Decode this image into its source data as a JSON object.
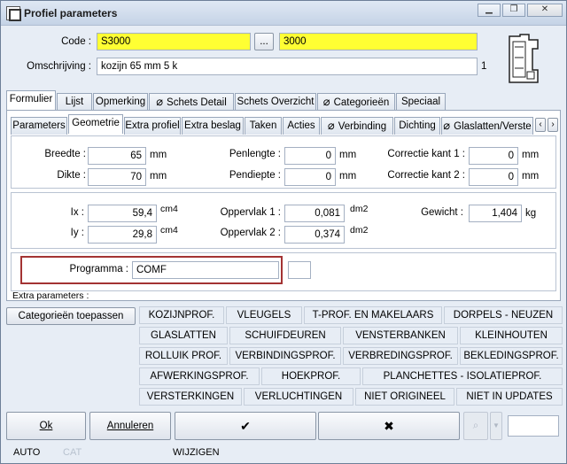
{
  "window": {
    "title": "Profiel parameters"
  },
  "header": {
    "code_label": "Code :",
    "code_value": "S3000",
    "browse_label": "...",
    "code2_value": "3000",
    "omschrijving_label": "Omschrijving :",
    "omschrijving_value": "kozijn 65 mm 5 k",
    "count": "1"
  },
  "main_tabs": [
    "Formulier",
    "Lijst",
    "Opmerking",
    "Schets Detail",
    "Schets Overzicht",
    "Categorieën",
    "Speciaal"
  ],
  "sub_tabs": [
    "Parameters",
    "Geometrie",
    "Extra profiel",
    "Extra beslag",
    "Taken",
    "Acties",
    "Verbinding",
    "Dichting",
    "Glaslatten/Verste"
  ],
  "geometry": {
    "breedte_label": "Breedte :",
    "breedte_value": "65",
    "breedte_unit": "mm",
    "dikte_label": "Dikte :",
    "dikte_value": "70",
    "dikte_unit": "mm",
    "penlengte_label": "Penlengte :",
    "penlengte_value": "0",
    "penlengte_unit": "mm",
    "pendiepte_label": "Pendiepte :",
    "pendiepte_value": "0",
    "pendiepte_unit": "mm",
    "correctie1_label": "Correctie kant 1 :",
    "correctie1_value": "0",
    "correctie1_unit": "mm",
    "correctie2_label": "Correctie kant 2 :",
    "correctie2_value": "0",
    "correctie2_unit": "mm"
  },
  "properties": {
    "ix_label": "Ix :",
    "ix_value": "59,4",
    "ix_unit": "cm4",
    "iy_label": "Iy :",
    "iy_value": "29,8",
    "iy_unit": "cm4",
    "opp1_label": "Oppervlak 1 :",
    "opp1_value": "0,081",
    "opp1_unit": "dm2",
    "opp2_label": "Oppervlak 2 :",
    "opp2_value": "0,374",
    "opp2_unit": "dm2",
    "gewicht_label": "Gewicht :",
    "gewicht_value": "1,404",
    "gewicht_unit": "kg"
  },
  "programma": {
    "label": "Programma :",
    "value": "COMF"
  },
  "extra_parameters_label": "Extra parameters :",
  "categories": {
    "apply_label": "Categorieën toepassen",
    "rows": [
      [
        "KOZIJNPROF.",
        "VLEUGELS",
        "T-PROF. EN MAKELAARS",
        "DORPELS - NEUZEN"
      ],
      [
        "GLASLATTEN",
        "SCHUIFDEUREN",
        "VENSTERBANKEN",
        "KLEINHOUTEN"
      ],
      [
        "ROLLUIK PROF.",
        "VERBINDINGSPROF.",
        "VERBREDINGSPROF.",
        "BEKLEDINGSPROF."
      ],
      [
        "AFWERKINGSPROF.",
        "HOEKPROF.",
        "PLANCHETTES - ISOLATIEPROF.",
        ""
      ],
      [
        "VERSTERKINGEN",
        "VERLUCHTINGEN",
        "NIET ORIGINEEL",
        "NIET IN UPDATES"
      ]
    ]
  },
  "footer": {
    "ok_label": "Ok",
    "annuleren_label": "Annuleren",
    "confirm_icon": "✔",
    "cancel_icon": "✖"
  },
  "statusbar": {
    "mode": "AUTO",
    "cat": "CAT",
    "state": "WIJZIGEN"
  }
}
